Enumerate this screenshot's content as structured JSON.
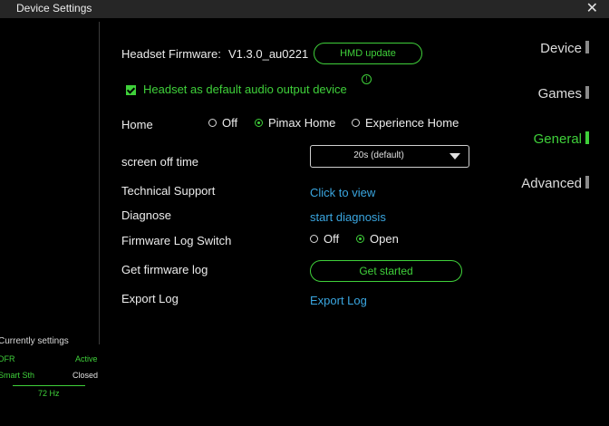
{
  "window": {
    "title": "Device Settings",
    "close_glyph": "✕"
  },
  "sidebar": {
    "items": [
      {
        "label": "Device",
        "active": false
      },
      {
        "label": "Games",
        "active": false
      },
      {
        "label": "General",
        "active": true
      },
      {
        "label": "Advanced",
        "active": false
      }
    ],
    "current": {
      "title": "Currently settings",
      "rows": [
        {
          "name": "DFR",
          "value": "Active"
        },
        {
          "name": "Smart Sth",
          "value": "Closed"
        }
      ],
      "refresh": "72 Hz"
    }
  },
  "main": {
    "firmware": {
      "label": "Headset Firmware:",
      "version": "V1.3.0_au0221",
      "button": "HMD update"
    },
    "audio_default": {
      "label": "Headset as default audio output device",
      "checked": true,
      "info_glyph": "!"
    },
    "home": {
      "label": "Home",
      "options": [
        "Off",
        "Pimax Home",
        "Experience Home"
      ],
      "selected": "Pimax Home"
    },
    "screen_off": {
      "label": "screen off time",
      "value": "20s (default)"
    },
    "tech_support": {
      "label": "Technical Support",
      "link": "Click to view"
    },
    "diagnose": {
      "label": "Diagnose",
      "link": "start diagnosis"
    },
    "fw_log_switch": {
      "label": "Firmware Log Switch",
      "options": [
        "Off",
        "Open"
      ],
      "selected": "Open"
    },
    "get_fw_log": {
      "label": "Get firmware log",
      "button": "Get started"
    },
    "export_log": {
      "label": "Export Log",
      "link": "Export Log"
    }
  },
  "colors": {
    "accent": "#3fd03a",
    "link": "#3aa6e0",
    "titlebar": "#262626",
    "background": "#000000"
  }
}
